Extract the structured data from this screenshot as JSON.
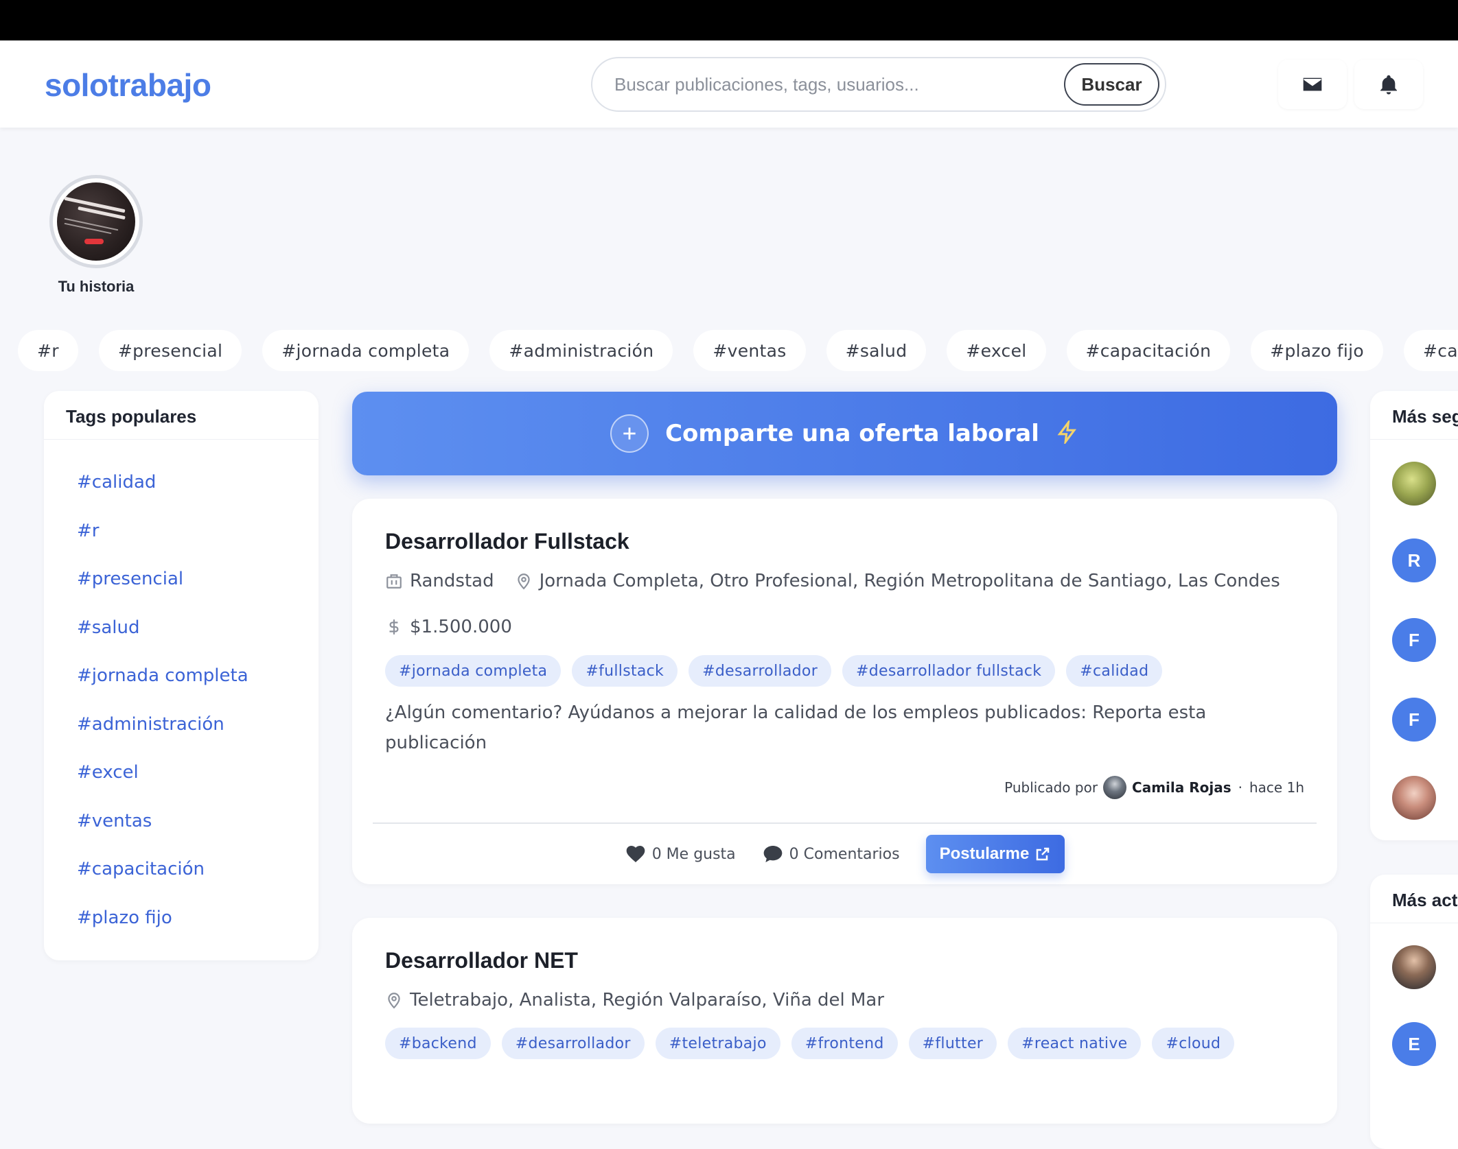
{
  "header": {
    "logo": "solotrabajo",
    "search_placeholder": "Buscar publicaciones, tags, usuarios...",
    "search_button": "Buscar"
  },
  "story": {
    "label": "Tu historia"
  },
  "tag_row": [
    "#r",
    "#presencial",
    "#jornada completa",
    "#administración",
    "#ventas",
    "#salud",
    "#excel",
    "#capacitación",
    "#plazo fijo",
    "#calidad"
  ],
  "left_sidebar": {
    "title": "Tags populares",
    "tags": [
      "#calidad",
      "#r",
      "#presencial",
      "#salud",
      "#jornada completa",
      "#administración",
      "#excel",
      "#ventas",
      "#capacitación",
      "#plazo fijo"
    ]
  },
  "share": {
    "label": "Comparte una oferta laboral"
  },
  "posts": [
    {
      "title": "Desarrollador Fullstack",
      "company": "Randstad",
      "location": "Jornada Completa, Otro Profesional, Región Metropolitana de Santiago, Las Condes",
      "salary": "$1.500.000",
      "tags": [
        "#jornada completa",
        "#fullstack",
        "#desarrollador",
        "#desarrollador fullstack",
        "#calidad"
      ],
      "description": "¿Algún comentario? Ayúdanos a mejorar la calidad de los empleos publicados:  Reporta esta publicación",
      "published_by_label": "Publicado por",
      "author": "Camila Rojas",
      "time": "hace 1h",
      "likes": "0 Me gusta",
      "comments": "0 Comentarios",
      "apply": "Postularme"
    },
    {
      "title": "Desarrollador NET",
      "location": "Teletrabajo, Analista, Región Valparaíso, Viña del Mar",
      "tags": [
        "#backend",
        "#desarrollador",
        "#teletrabajo",
        "#frontend",
        "#flutter",
        "#react native",
        "#cloud"
      ]
    }
  ],
  "right_sidebar": {
    "followed_title": "Más seg",
    "followed_avatars": [
      "R",
      "F",
      "F"
    ],
    "active_title": "Más act",
    "active_avatars": [
      "E"
    ]
  },
  "colors": {
    "brand": "#4c7de6",
    "accent": "#3d6be2",
    "chip_bg": "#e6edfc",
    "chip_text": "#3a5ec8"
  },
  "icons": [
    "mail-icon",
    "bell-icon",
    "plus-icon",
    "bolt-icon",
    "building-icon",
    "location-pin-icon",
    "dollar-icon",
    "heart-icon",
    "comment-icon",
    "external-link-icon"
  ]
}
